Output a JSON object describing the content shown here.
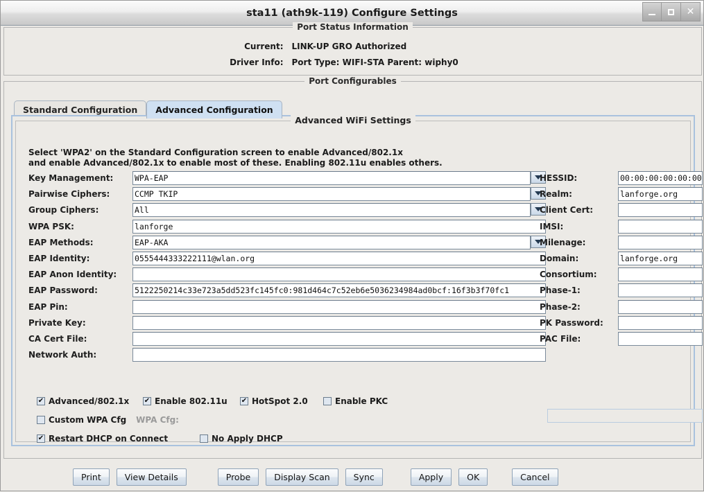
{
  "window": {
    "title": "sta11  (ath9k-119) Configure Settings",
    "controls": {
      "minimize": "_",
      "maximize": "□",
      "close": "✕"
    }
  },
  "status_panel": {
    "title": "Port Status Information",
    "current_label": "Current:",
    "current_value": "LINK-UP GRO  Authorized",
    "driver_label": "Driver Info:",
    "driver_value": "Port Type: WIFI-STA   Parent: wiphy0"
  },
  "cfg_panel": {
    "title": "Port Configurables"
  },
  "tabs": [
    {
      "label": "Standard Configuration",
      "active": false
    },
    {
      "label": "Advanced Configuration",
      "active": true
    }
  ],
  "advanced": {
    "title": "Advanced WiFi Settings",
    "note_line1": "Select 'WPA2' on the Standard Configuration screen to enable Advanced/802.1x",
    "note_line2": "and enable Advanced/802.1x to enable most of these. Enabling 802.11u enables others.",
    "left_fields": [
      {
        "label": "Key Management:",
        "value": "WPA-EAP",
        "combo": true
      },
      {
        "label": "Pairwise Ciphers:",
        "value": "CCMP TKIP",
        "combo": true
      },
      {
        "label": "Group Ciphers:",
        "value": "All",
        "combo": true
      },
      {
        "label": "WPA PSK:",
        "value": "lanforge",
        "combo": false
      },
      {
        "label": "EAP Methods:",
        "value": "EAP-AKA",
        "combo": true
      },
      {
        "label": "EAP Identity:",
        "value": "0555444333222111@wlan.org",
        "combo": false
      },
      {
        "label": "EAP Anon Identity:",
        "value": "",
        "combo": false
      },
      {
        "label": "EAP Password:",
        "value": "5122250214c33e723a5dd523fc145fc0:981d464c7c52eb6e5036234984ad0bcf:16f3b3f70fc1",
        "combo": false
      },
      {
        "label": "EAP Pin:",
        "value": "",
        "combo": false
      },
      {
        "label": "Private Key:",
        "value": "",
        "combo": false
      },
      {
        "label": "CA Cert File:",
        "value": "",
        "combo": false
      },
      {
        "label": "Network Auth:",
        "value": "",
        "combo": false
      }
    ],
    "right_fields": [
      {
        "label": "HESSID:",
        "value": "00:00:00:00:00:00"
      },
      {
        "label": "Realm:",
        "value": "lanforge.org"
      },
      {
        "label": "Client Cert:",
        "value": ""
      },
      {
        "label": "IMSI:",
        "value": ""
      },
      {
        "label": "Milenage:",
        "value": ""
      },
      {
        "label": "Domain:",
        "value": "lanforge.org"
      },
      {
        "label": "Consortium:",
        "value": ""
      },
      {
        "label": "Phase-1:",
        "value": ""
      },
      {
        "label": "Phase-2:",
        "value": ""
      },
      {
        "label": "PK Password:",
        "value": ""
      },
      {
        "label": "PAC File:",
        "value": ""
      }
    ],
    "checkbox_row1": [
      {
        "label": "Advanced/802.1x",
        "checked": true
      },
      {
        "label": "Enable 802.11u",
        "checked": true
      },
      {
        "label": "HotSpot 2.0",
        "checked": true
      },
      {
        "label": "Enable PKC",
        "checked": false
      }
    ],
    "checkbox_row2": [
      {
        "label": "Custom WPA Cfg",
        "checked": false
      }
    ],
    "wpa_cfg_label": "WPA Cfg:",
    "wpa_cfg_value": "",
    "checkbox_row3": [
      {
        "label": "Restart DHCP on Connect",
        "checked": true
      },
      {
        "label": "No Apply DHCP",
        "checked": false
      }
    ]
  },
  "buttons": [
    {
      "label": "Print"
    },
    {
      "label": "View Details"
    },
    {
      "label": "Probe"
    },
    {
      "label": "Display Scan"
    },
    {
      "label": "Sync"
    },
    {
      "label": "Apply"
    },
    {
      "label": "OK"
    },
    {
      "label": "Cancel"
    }
  ]
}
